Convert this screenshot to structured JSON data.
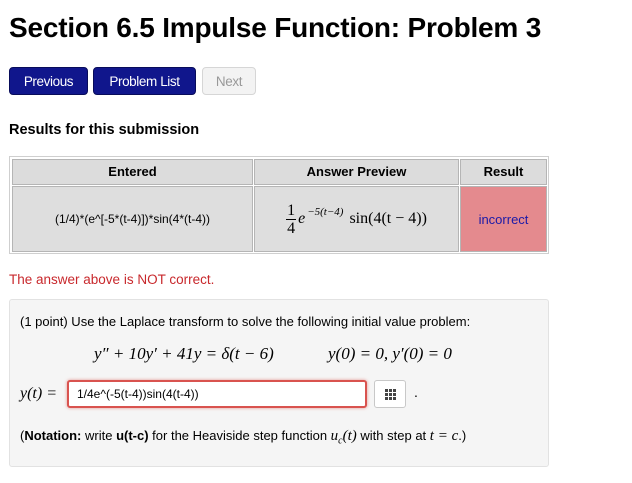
{
  "page": {
    "title": "Section 6.5 Impulse Function: Problem 3"
  },
  "nav": {
    "previous_label": "Previous",
    "problem_list_label": "Problem List",
    "next_label": "Next"
  },
  "results": {
    "heading": "Results for this submission",
    "columns": [
      "Entered",
      "Answer Preview",
      "Result"
    ],
    "entered": "(1/4)*(e^[-5*(t-4)])*sin(4*(t-4))",
    "preview": {
      "frac_num": "1",
      "frac_den": "4",
      "e": "e",
      "exponent": "−5(t−4)",
      "tail": "sin(4(t − 4))"
    },
    "result": "incorrect",
    "status_message": "The answer above is NOT correct.",
    "colors": {
      "incorrect_bg": "#e48a8e",
      "error_text": "#c8282c",
      "button_primary": "#10168c"
    }
  },
  "problem": {
    "intro": "(1 point) Use the Laplace transform to solve the following initial value problem:",
    "equation": "y″ + 10y′ + 41y = δ(t − 6)",
    "initial_conditions": "y(0) = 0,  y′(0) = 0",
    "answer_label": "y(t) =",
    "answer_value": "1/4e^(-5(t-4))sin(4(t-4))",
    "keyboard_icon": "grid-icon",
    "period": ".",
    "notation_bold": "Notation:",
    "notation_text1": " write ",
    "notation_code": "u(t-c)",
    "notation_text2": " for the Heaviside step function ",
    "notation_math1": "u",
    "notation_sub": "c",
    "notation_math2": "(t)",
    "notation_text3": " with step at ",
    "notation_math3": "t = c",
    "notation_close": ".)",
    "notation_open": "("
  }
}
